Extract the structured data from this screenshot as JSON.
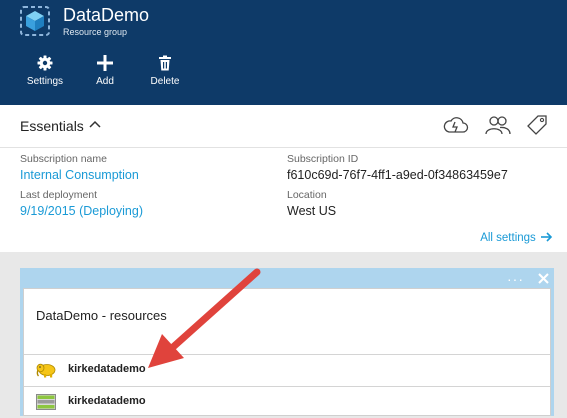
{
  "header": {
    "title": "DataDemo",
    "subtitle": "Resource group",
    "background": "#0e3a68",
    "commands": [
      {
        "label": "Settings",
        "icon": "gear-icon"
      },
      {
        "label": "Add",
        "icon": "plus-icon"
      },
      {
        "label": "Delete",
        "icon": "trash-icon"
      }
    ]
  },
  "essentials": {
    "title": "Essentials",
    "subscription_name_label": "Subscription name",
    "subscription_name": "Internal Consumption",
    "subscription_id_label": "Subscription ID",
    "subscription_id": "f610c69d-76f7-4ff1-a9ed-0f34863459e7",
    "last_deployment_label": "Last deployment",
    "last_deployment": "9/19/2015 (Deploying)",
    "location_label": "Location",
    "location": "West US",
    "all_settings": "All settings",
    "tools": [
      "cloud-icon",
      "users-icon",
      "tag-icon"
    ]
  },
  "resources": {
    "title": "DataDemo - resources",
    "more": "···",
    "items": [
      {
        "name": "kirkedatademo",
        "icon": "hadoop-elephant-icon"
      },
      {
        "name": "kirkedatademo",
        "icon": "storage-account-icon"
      }
    ]
  },
  "colors": {
    "accent": "#1a9ad6",
    "annotation_arrow": "#e0433c",
    "blade_header": "#aed5ee"
  }
}
